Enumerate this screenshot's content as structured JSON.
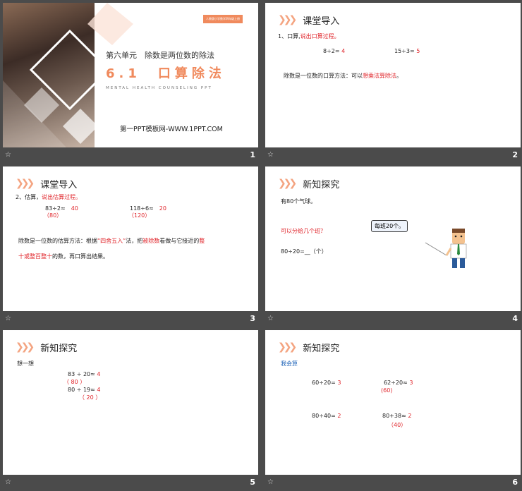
{
  "slides": [
    {
      "number": "1",
      "tag": "人教版小学数学四年级上册",
      "unit_title": "第六单元　除数是两位数的除法",
      "big_title": "6.1　口算除法",
      "english": "MENTAL HEALTH COUNSELING PPT",
      "url": "第一PPT模板网-WWW.1PPT.COM"
    },
    {
      "number": "2",
      "section": "课堂导入",
      "line1_prefix": "1、口算,",
      "line1_red": "说出口算过程。",
      "eq1": "8÷2=",
      "eq1_ans": "4",
      "eq2": "15÷3=",
      "eq2_ans": "5",
      "method_prefix": "除数是一位数的口算方法：可以",
      "method_red": "想乘法算除法",
      "method_suffix": "。"
    },
    {
      "number": "3",
      "section": "课堂导入",
      "line1_prefix": "2、估算，",
      "line1_red": "说出估算过程。",
      "eq1": "83÷2≈",
      "eq1_ans": "40",
      "eq1_sub": "（80）",
      "eq2": "118÷6≈",
      "eq2_ans": "20",
      "eq2_sub": "（120）",
      "m1": "除数是一位数的估算方法：根据",
      "m1_red": "“四舍五入”",
      "m1b": "法，把",
      "m1_red2": "被除数",
      "m1c": "看做与它接近的",
      "m1_red3": "整",
      "m2_red": "十或整百整十",
      "m2": "的数，再口算出结果。"
    },
    {
      "number": "4",
      "section": "新知探究",
      "line1": "有80个气球。",
      "question": "可以分给几个班？",
      "bubble": "每班20个。",
      "eq": "80÷20=__（个）"
    },
    {
      "number": "5",
      "section": "新知探究",
      "think": "想一想",
      "eq1": "83 ÷ 20≈",
      "eq1_ans": "4",
      "eq1_sub": "（ 80 ）",
      "eq2": "80 ÷ 19≈",
      "eq2_ans": "4",
      "eq2_sub": "（ 20 ）"
    },
    {
      "number": "6",
      "section": "新知探究",
      "label": "我会算",
      "eq1": "60÷20=",
      "eq1_ans": "3",
      "eq2": "62÷20≈",
      "eq2_ans": "3",
      "eq2_sub": "(60)",
      "eq3": "80÷40=",
      "eq3_ans": "2",
      "eq4": "80+38≈",
      "eq4_ans": "2",
      "eq4_sub": "（40）"
    }
  ],
  "colors": {
    "accent": "#f08a5d",
    "red": "#e0242a",
    "blue": "#1e63b8",
    "bg": "#4b4b4b"
  },
  "footer_icon": "star-icon"
}
